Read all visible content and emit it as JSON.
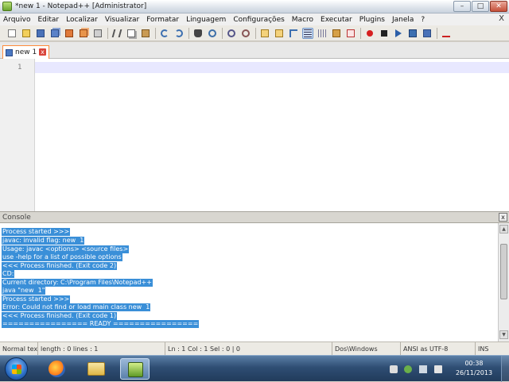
{
  "window": {
    "title": "*new  1 - Notepad++ [Administrator]",
    "minimize_glyph": "–",
    "maximize_glyph": "□",
    "close_glyph": "✕"
  },
  "menu": {
    "items": [
      "Arquivo",
      "Editar",
      "Localizar",
      "Visualizar",
      "Formatar",
      "Linguagem",
      "Configurações",
      "Macro",
      "Executar",
      "Plugins",
      "Janela",
      "?"
    ],
    "close_x": "X"
  },
  "toolbar": {
    "icons": [
      "new-file-icon",
      "open-file-icon",
      "save-icon",
      "save-all-icon",
      "close-icon",
      "close-all-icon",
      "print-icon",
      "cut-icon",
      "copy-icon",
      "paste-icon",
      "undo-icon",
      "redo-icon",
      "find-icon",
      "replace-icon",
      "zoom-in-icon",
      "zoom-out-icon",
      "sync-vertical-icon",
      "sync-horizontal-icon",
      "word-wrap-icon",
      "show-all-chars-icon",
      "indent-guide-icon",
      "doc-map-icon",
      "function-list-icon",
      "record-macro-icon",
      "stop-record-icon",
      "play-macro-icon",
      "play-multiple-icon",
      "save-macro-icon",
      "spellcheck-icon"
    ]
  },
  "tab": {
    "label": "new  1",
    "close_glyph": "x"
  },
  "editor": {
    "line_number": "1"
  },
  "console": {
    "title": "Console",
    "close_glyph": "x",
    "lines": [
      "Process started >>>",
      "javac: invalid flag: new  1",
      "Usage: javac <options> <source files>",
      "use -help for a list of possible options",
      "<<< Process finished. (Exit code 2)",
      "CD:",
      "Current directory: C:\\Program Files\\Notepad++",
      "java \"new  1\"",
      "Process started >>>",
      "Error: Could not find or load main class new  1",
      "<<< Process finished. (Exit code 1)",
      "================ READY ================"
    ]
  },
  "statusbar": {
    "doc_type": "Normal text file",
    "length": "length : 0    lines : 1",
    "position": "Ln : 1    Col : 1    Sel : 0 | 0",
    "eol": "Dos\\Windows",
    "encoding": "ANSI as UTF-8",
    "mode": "INS"
  },
  "taskbar": {
    "time": "00:38",
    "date": "26/11/2013"
  },
  "colors": {
    "console_selection": "#3a8fd8",
    "current_line": "#e8e8ff",
    "tab_accent": "#ff8a3a"
  }
}
